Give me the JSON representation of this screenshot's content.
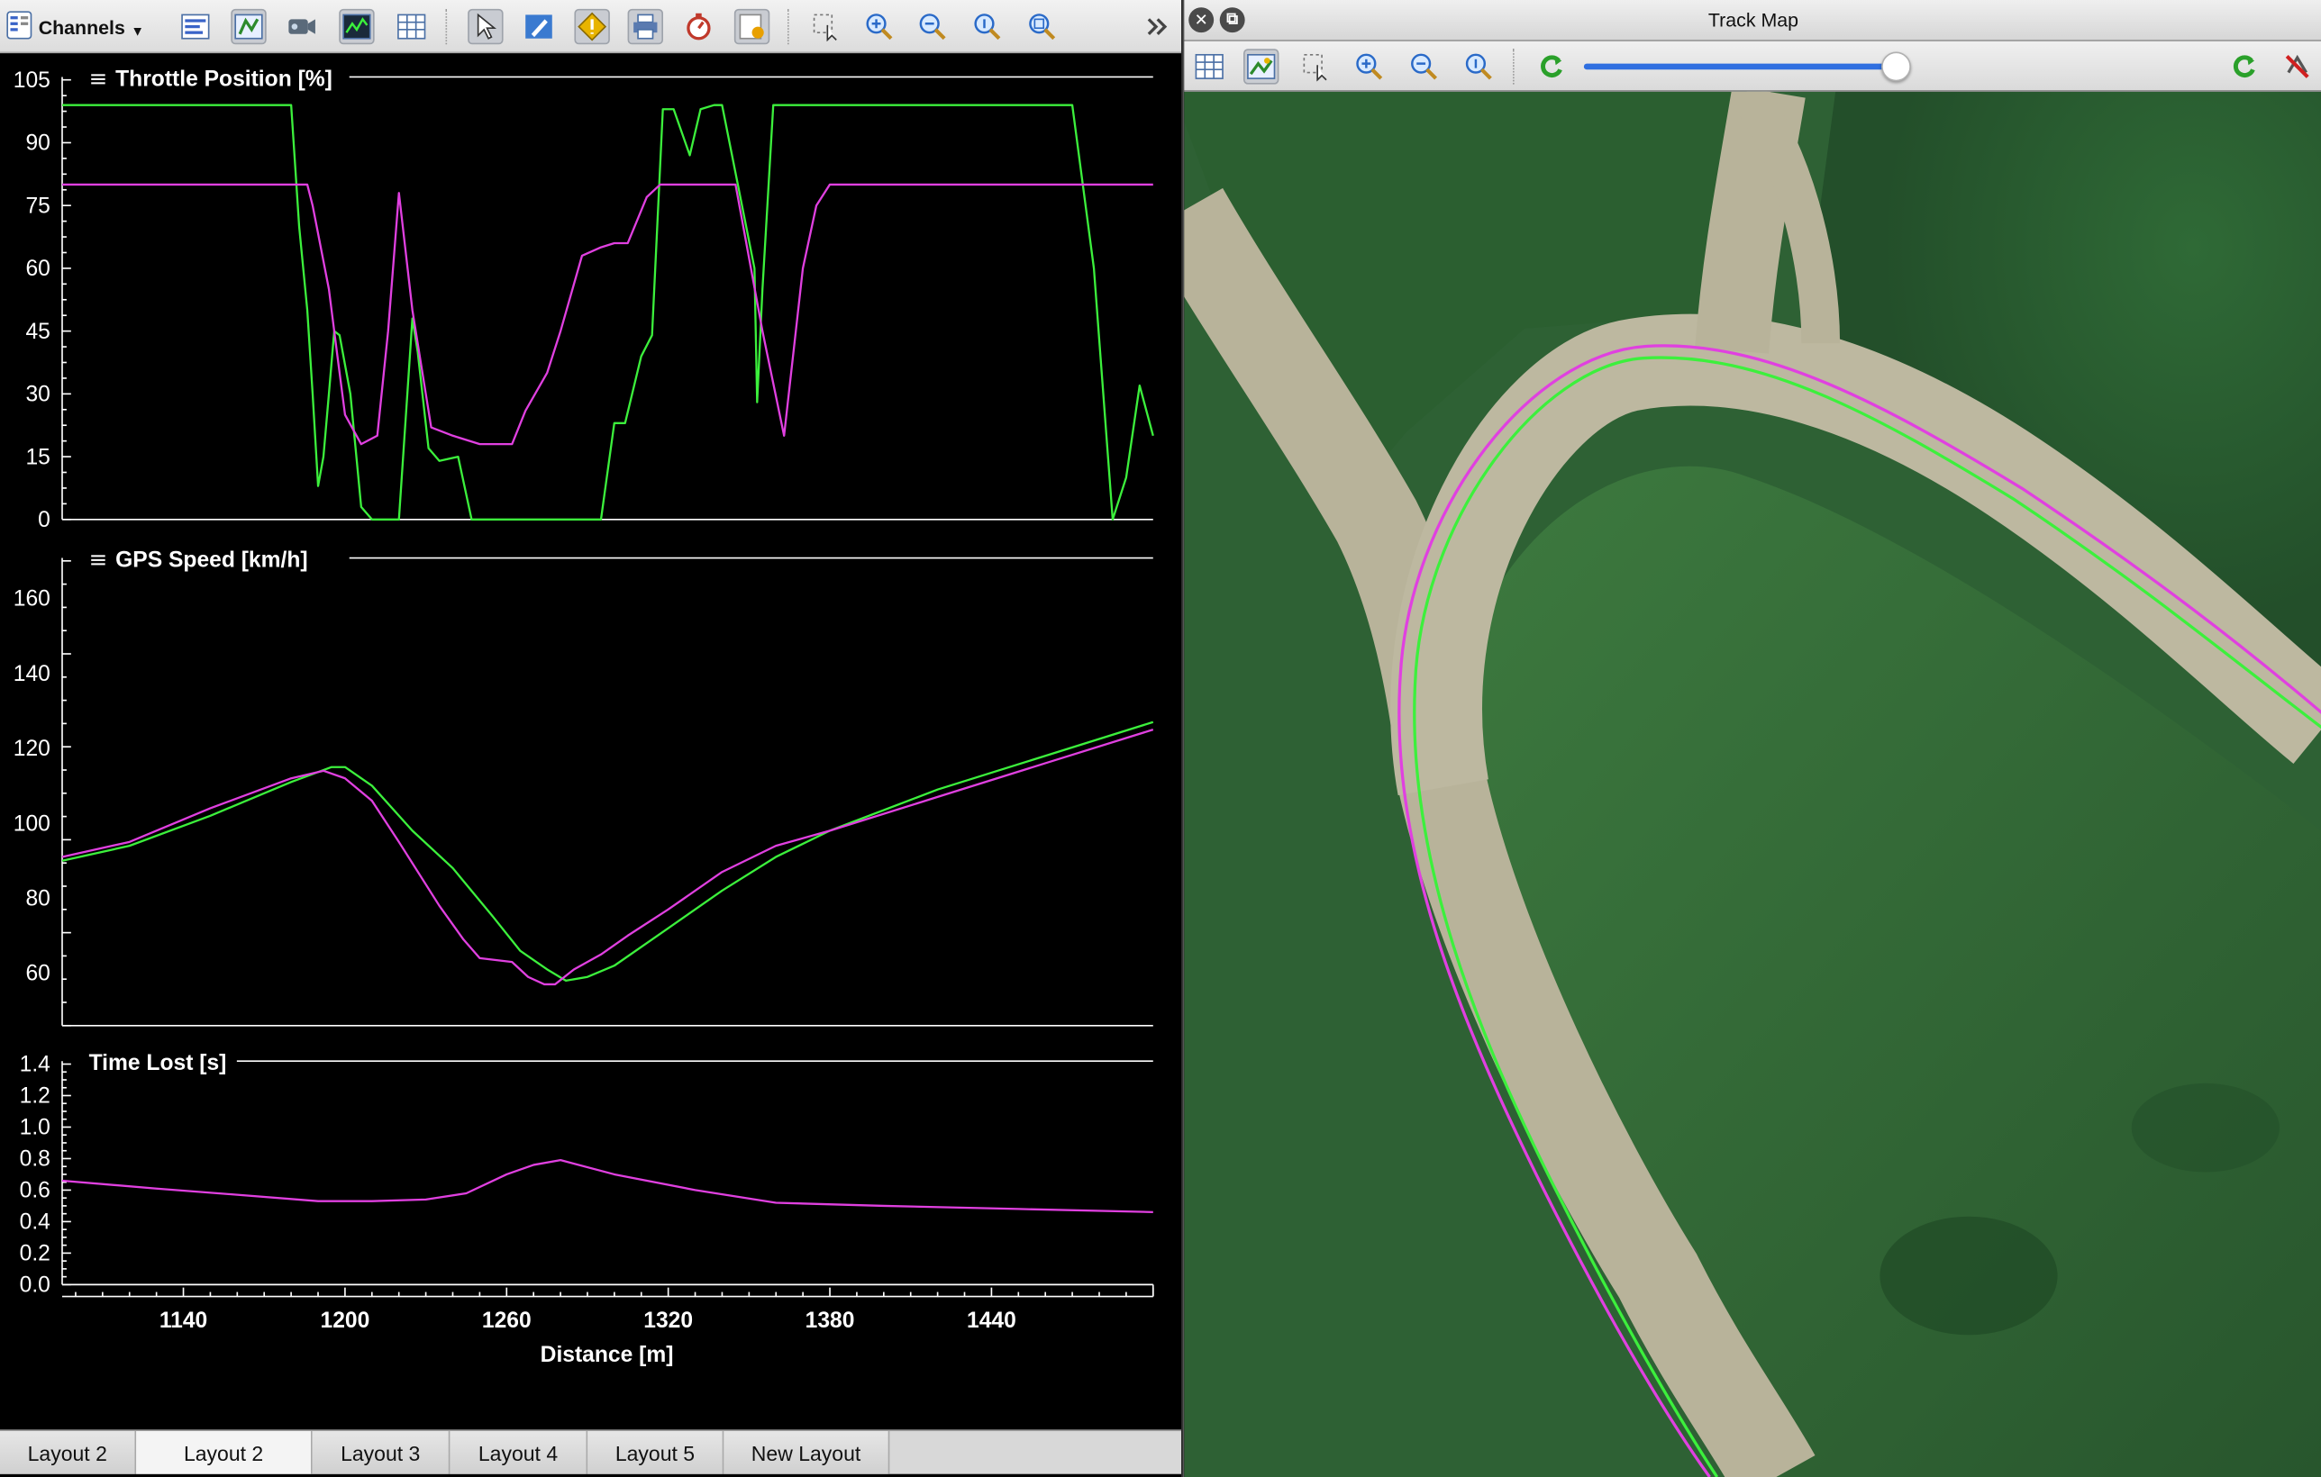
{
  "left_toolbar": {
    "channels_label": "Channels",
    "icons": [
      "channels-list-icon",
      "text-panel-icon",
      "map-panel-icon",
      "video-icon",
      "graph-icon",
      "grid-icon",
      "pointer-icon",
      "pencil-icon",
      "marker-icon",
      "print-icon",
      "stopwatch-icon",
      "report-icon",
      "zoom-select-icon",
      "zoom-in-icon",
      "zoom-out-icon",
      "zoom-reset-icon",
      "zoom-fit-icon",
      "overflow-chevron-icon"
    ]
  },
  "colors": {
    "reference_lap": "#3cf03c",
    "comparison_lap": "#e040e0",
    "axis": "#ffffff",
    "background": "#000000"
  },
  "chart_data": [
    {
      "type": "line",
      "title": "Throttle Position [%]",
      "ylim": [
        0,
        105
      ],
      "yticks": [
        "105",
        "90",
        "75",
        "60",
        "45",
        "30",
        "15",
        "0"
      ],
      "xlim": [
        1095,
        1500
      ],
      "series": [
        {
          "color": "#3cf03c",
          "x": [
            1095,
            1180,
            1183,
            1186,
            1188,
            1190,
            1192,
            1194,
            1196,
            1198,
            1202,
            1206,
            1210,
            1216,
            1220,
            1225,
            1227,
            1231,
            1235,
            1242,
            1247,
            1260,
            1275,
            1280,
            1286,
            1291,
            1295,
            1300,
            1304,
            1310,
            1314,
            1318,
            1322,
            1328,
            1332,
            1337,
            1340,
            1352,
            1353,
            1355,
            1359,
            1364,
            1369,
            1372,
            1380,
            1412,
            1445,
            1458,
            1470,
            1478,
            1485,
            1490,
            1495,
            1500
          ],
          "y": [
            99,
            99,
            70,
            50,
            30,
            8,
            15,
            30,
            45,
            44,
            30,
            3,
            0,
            0,
            0,
            48,
            40,
            17,
            14,
            15,
            0,
            0,
            0,
            0,
            0,
            0,
            0,
            23,
            23,
            39,
            44,
            98,
            98,
            87,
            98,
            99,
            99,
            60,
            28,
            55,
            99,
            99,
            99,
            99,
            99,
            99,
            99,
            99,
            99,
            60,
            0,
            10,
            32,
            20
          ]
        },
        {
          "color": "#e040e0",
          "x": [
            1095,
            1170,
            1183,
            1186,
            1188,
            1191,
            1194,
            1197,
            1200,
            1206,
            1212,
            1216,
            1220,
            1225,
            1232,
            1240,
            1250,
            1262,
            1267,
            1275,
            1280,
            1288,
            1295,
            1300,
            1305,
            1312,
            1317,
            1322,
            1330,
            1345,
            1355,
            1363,
            1370,
            1375,
            1380,
            1400,
            1440,
            1470,
            1500
          ],
          "y": [
            80,
            80,
            80,
            80,
            75,
            65,
            55,
            40,
            25,
            18,
            20,
            45,
            78,
            50,
            22,
            20,
            18,
            18,
            26,
            35,
            45,
            63,
            65,
            66,
            66,
            77,
            80,
            80,
            80,
            80,
            45,
            20,
            60,
            75,
            80,
            80,
            80,
            80,
            80
          ]
        }
      ]
    },
    {
      "type": "line",
      "title": "GPS Speed [km/h]",
      "ylim": [
        46,
        170
      ],
      "yticks": [
        "160",
        "140",
        "120",
        "100",
        "80",
        "60"
      ],
      "xlim": [
        1095,
        1500
      ],
      "series": [
        {
          "color": "#3cf03c",
          "x": [
            1095,
            1120,
            1150,
            1180,
            1195,
            1200,
            1210,
            1225,
            1240,
            1255,
            1265,
            1275,
            1282,
            1290,
            1300,
            1320,
            1340,
            1360,
            1380,
            1420,
            1460,
            1500
          ],
          "y": [
            90,
            94,
            102,
            111,
            115,
            115,
            110,
            98,
            88,
            75,
            66,
            61,
            58,
            59,
            62,
            72,
            82,
            91,
            98,
            109,
            118,
            127
          ]
        },
        {
          "color": "#e040e0",
          "x": [
            1095,
            1120,
            1150,
            1180,
            1192,
            1200,
            1210,
            1220,
            1235,
            1244,
            1250,
            1262,
            1268,
            1274,
            1278,
            1285,
            1295,
            1305,
            1320,
            1340,
            1360,
            1380,
            1420,
            1460,
            1500
          ],
          "y": [
            91,
            95,
            104,
            112,
            114,
            112,
            106,
            95,
            78,
            69,
            64,
            63,
            59,
            57,
            57,
            61,
            65,
            70,
            77,
            87,
            94,
            98,
            107,
            116,
            125
          ]
        }
      ]
    },
    {
      "type": "line",
      "title": "Time Lost [s]",
      "ylim": [
        0,
        1.4
      ],
      "yticks": [
        "1.4",
        "1.2",
        "1.0",
        "0.8",
        "0.6",
        "0.4",
        "0.2",
        "0.0"
      ],
      "xlim": [
        1095,
        1500
      ],
      "series": [
        {
          "color": "#e040e0",
          "x": [
            1095,
            1130,
            1160,
            1190,
            1210,
            1230,
            1245,
            1260,
            1270,
            1280,
            1300,
            1330,
            1360,
            1400,
            1450,
            1500
          ],
          "y": [
            0.66,
            0.61,
            0.57,
            0.53,
            0.53,
            0.54,
            0.58,
            0.7,
            0.76,
            0.79,
            0.7,
            0.6,
            0.52,
            0.5,
            0.48,
            0.46
          ]
        }
      ]
    }
  ],
  "x_axis": {
    "label": "Distance [m]",
    "ticks": [
      1140,
      1200,
      1260,
      1320,
      1380,
      1440
    ]
  },
  "tabs": [
    "Layout 2",
    "Layout 2",
    "Layout 3",
    "Layout 4",
    "Layout 5",
    "New Layout"
  ],
  "active_tab_index": 1,
  "track_map": {
    "title": "Track Map",
    "close_icon": "close-icon",
    "restore_icon": "restore-icon",
    "toolbar_icons": [
      "grid-icon",
      "satellite-image-icon",
      "zoom-select-icon",
      "zoom-in-icon",
      "zoom-out-icon",
      "zoom-reset-icon",
      "rotate-icon",
      "refresh-icon",
      "no-sync-icon"
    ],
    "zoom_level": 0.93
  }
}
